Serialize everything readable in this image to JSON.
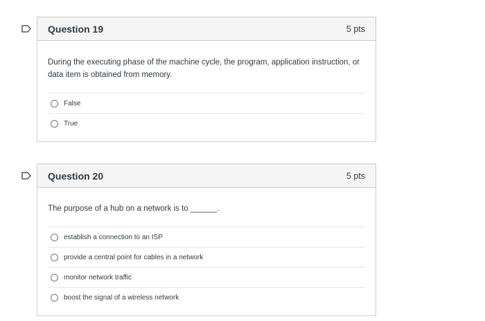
{
  "questions": [
    {
      "title": "Question 19",
      "points": "5 pts",
      "text": "During the executing phase of the machine cycle, the program, application instruction, or data item is obtained from memory.",
      "answers": [
        "False",
        "True"
      ]
    },
    {
      "title": "Question 20",
      "points": "5 pts",
      "text": "The purpose of a hub on a network is to ______.",
      "answers": [
        "establish a connection to an ISP",
        "provide a central point for cables in a network",
        "monitor network traffic",
        "boost the signal of a wireless network"
      ]
    }
  ],
  "colors": {
    "border": "#c7cdd1",
    "header_bg": "#f5f5f5",
    "flag": "#2d3b45"
  },
  "icons": {
    "flag": "flag-question-icon",
    "radio": "radio-button-icon"
  }
}
